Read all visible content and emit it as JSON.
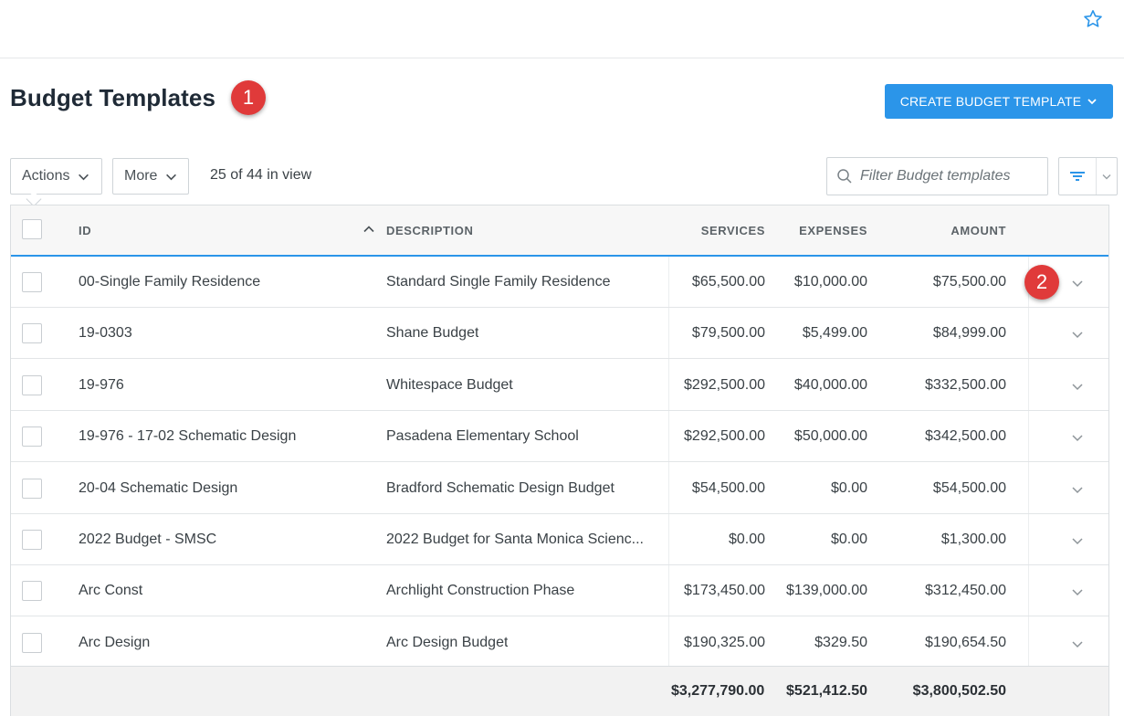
{
  "header": {
    "favorite_icon": "star-outline-icon"
  },
  "page": {
    "title": "Budget Templates",
    "create_button_label": "CREATE BUDGET TEMPLATE",
    "accent_color": "#2b95e9",
    "callout_color": "#e03a3a"
  },
  "callouts": [
    "1",
    "2"
  ],
  "toolbar": {
    "actions_label": "Actions",
    "more_label": "More",
    "view_count": "25 of 44 in view",
    "filter_placeholder": "Filter Budget templates"
  },
  "table": {
    "columns": {
      "id": "ID",
      "description": "DESCRIPTION",
      "services": "SERVICES",
      "expenses": "EXPENSES",
      "amount": "AMOUNT"
    },
    "sort": {
      "column": "id",
      "direction": "ascending"
    },
    "rows": [
      {
        "id": "00-Single Family Residence",
        "description": "Standard Single Family Residence",
        "services": "$65,500.00",
        "expenses": "$10,000.00",
        "amount": "$75,500.00"
      },
      {
        "id": "19-0303",
        "description": "Shane Budget",
        "services": "$79,500.00",
        "expenses": "$5,499.00",
        "amount": "$84,999.00"
      },
      {
        "id": "19-976",
        "description": "Whitespace Budget",
        "services": "$292,500.00",
        "expenses": "$40,000.00",
        "amount": "$332,500.00"
      },
      {
        "id": "19-976 - 17-02 Schematic Design",
        "description": "Pasadena Elementary School",
        "services": "$292,500.00",
        "expenses": "$50,000.00",
        "amount": "$342,500.00"
      },
      {
        "id": "20-04 Schematic Design",
        "description": "Bradford Schematic Design Budget",
        "services": "$54,500.00",
        "expenses": "$0.00",
        "amount": "$54,500.00"
      },
      {
        "id": "2022 Budget - SMSC",
        "description": "2022 Budget for Santa Monica Scienc...",
        "services": "$0.00",
        "expenses": "$0.00",
        "amount": "$1,300.00"
      },
      {
        "id": "Arc Const",
        "description": "Archlight Construction Phase",
        "services": "$173,450.00",
        "expenses": "$139,000.00",
        "amount": "$312,450.00"
      },
      {
        "id": "Arc Design",
        "description": "Arc Design Budget",
        "services": "$190,325.00",
        "expenses": "$329.50",
        "amount": "$190,654.50"
      }
    ],
    "totals": {
      "services": "$3,277,790.00",
      "expenses": "$521,412.50",
      "amount": "$3,800,502.50"
    }
  }
}
